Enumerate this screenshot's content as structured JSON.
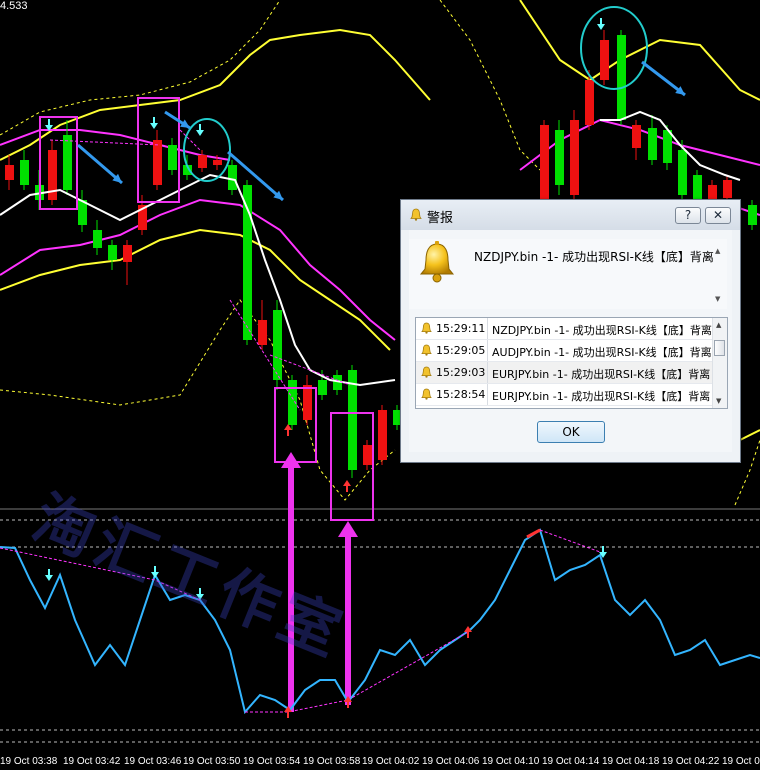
{
  "price_label": "4.533",
  "watermark": "淘汇工作室",
  "time_axis": [
    "19 Oct 03:38",
    "19 Oct 03:42",
    "19 Oct 03:46",
    "19 Oct 03:50",
    "19 Oct 03:54",
    "19 Oct 03:58",
    "19 Oct 04:02",
    "19 Oct 04:06",
    "19 Oct 04:10",
    "19 Oct 04:14",
    "19 Oct 04:18",
    "19 Oct 04:22",
    "19 Oct 04"
  ],
  "colors": {
    "bull": "#00e000",
    "bear": "#ee1111",
    "band_outer": "#ffff33",
    "band_inner": "#ff33ff",
    "ma": "#ffffff",
    "rsi": "#33b5ff",
    "marker_box": "#ee33ee",
    "circle": "#22cccc",
    "arrow": "#3399ee"
  },
  "dialog": {
    "title": "警报",
    "help_label": "?",
    "close_label": "✕",
    "message": "NZDJPY.bin -1- 成功出现RSI-K线【底】背离",
    "ok_label": "OK",
    "alerts": [
      {
        "time": "15:29:11",
        "text": "NZDJPY.bin -1- 成功出现RSI-K线【底】背离"
      },
      {
        "time": "15:29:05",
        "text": "AUDJPY.bin -1- 成功出现RSI-K线【底】背离"
      },
      {
        "time": "15:29:03",
        "text": "EURJPY.bin -1- 成功出现RSI-K线【底】背离"
      },
      {
        "time": "15:28:54",
        "text": "EURJPY.bin -1- 成功出现RSI-K线【底】背离"
      }
    ]
  },
  "icons": {
    "title_icon": "bell-icon",
    "message_icon": "bell-icon",
    "row_icon": "bell-icon"
  }
}
